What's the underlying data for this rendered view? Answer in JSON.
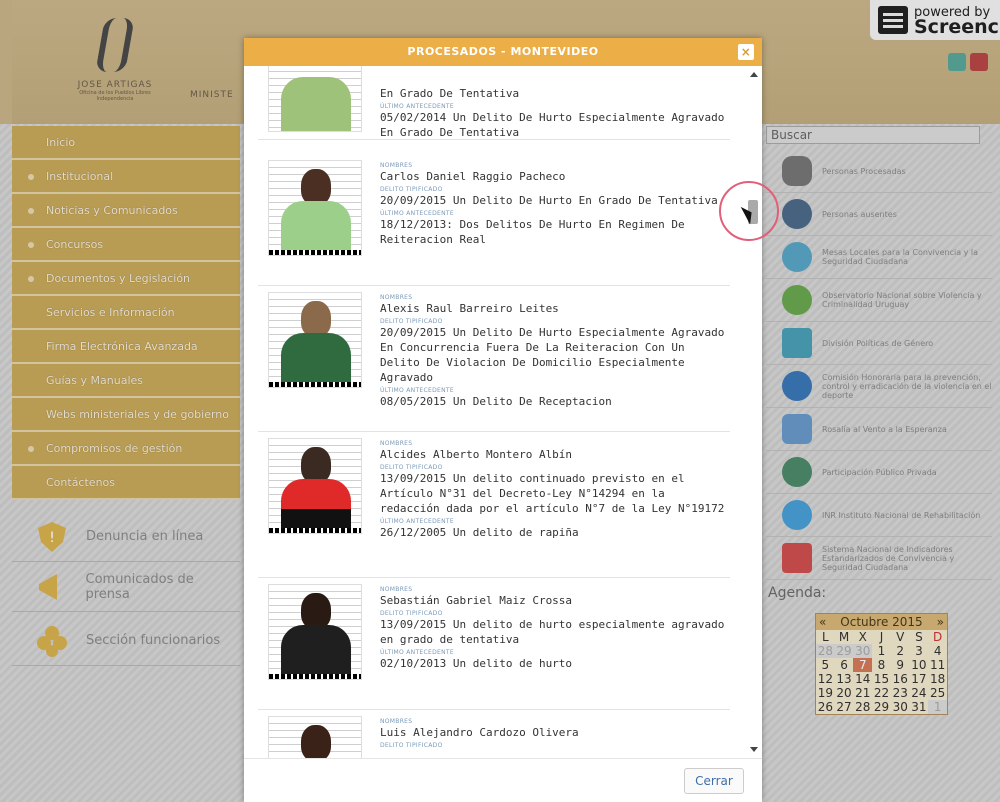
{
  "header": {
    "logo_name": "JOSE ARTIGAS",
    "logo_subtitle": "Oficina de los Pueblos Libres",
    "logo_subtitle2": "Independencia",
    "ministry": "MINISTE",
    "screencast_line1": "powered by",
    "screencast_line2": "Screenc"
  },
  "nav": {
    "items": [
      "Inicio",
      "Institucional",
      "Noticias y Comunicados",
      "Concursos",
      "Documentos y Legislación",
      "Servicios e Información",
      "Firma Electrónica Avanzada",
      "Guías y Manuales",
      "Webs ministeriales y de gobierno",
      "Compromisos de gestión",
      "Contáctenos"
    ]
  },
  "side_links": [
    "Denuncia en línea",
    "Comunicados de prensa",
    "Sección funcionarios"
  ],
  "right": {
    "search_label": "Buscar",
    "items": [
      "Personas Procesadas",
      "Personas ausentes",
      "Mesas Locales para la Convivencia y la Seguridad Ciudadana",
      "Observatorio Nacional sobre Violencia y Criminalidad Uruguay",
      "División Políticas de Género",
      "Comisión Honoraria para la prevención, control y erradicación de la violencia en el deporte",
      "Rosalía al Vento a la Esperanza",
      "Participación Público Privada",
      "INR Instituto Nacional de Rehabilitación",
      "Sistema Nacional de Indicadores Estandarizados de Convivencia y Seguridad Ciudadana"
    ],
    "agenda_label": "Agenda:",
    "calendar": {
      "month": "Octubre 2015",
      "prev": "«",
      "next": "»",
      "weekdays": [
        "L",
        "M",
        "X",
        "J",
        "V",
        "S",
        "D"
      ],
      "days": [
        "28",
        "29",
        "30",
        "1",
        "2",
        "3",
        "4",
        "5",
        "6",
        "7",
        "8",
        "9",
        "10",
        "11",
        "12",
        "13",
        "14",
        "15",
        "16",
        "17",
        "18",
        "19",
        "20",
        "21",
        "22",
        "23",
        "24",
        "25",
        "26",
        "27",
        "28",
        "29",
        "30",
        "31",
        "1"
      ]
    }
  },
  "modal": {
    "title": "PROCESADOS - MONTEVIDEO",
    "close_symbol": "×",
    "close_button": "Cerrar",
    "labels": {
      "nombres": "NOMBRES",
      "delito": "DELITO TIPIFICADO",
      "antecedente": "ÚLTIMO ANTECEDENTE"
    },
    "entries": [
      {
        "nombres": "",
        "delito": "En Grado De Tentativa",
        "antecedente": "05/02/2014 Un Delito De Hurto Especialmente Agravado En Grado De Tentativa"
      },
      {
        "nombres": "Carlos Daniel Raggio Pacheco",
        "delito": "20/09/2015 Un Delito De Hurto En Grado De Tentativa",
        "antecedente": "18/12/2013: Dos Delitos De Hurto En Regimen De Reiteracion Real"
      },
      {
        "nombres": "Alexis Raul Barreiro Leites",
        "delito": "20/09/2015 Un Delito De Hurto Especialmente Agravado En Concurrencia Fuera De La Reiteracion Con Un Delito De Violacion De Domicilio Especialmente Agravado",
        "antecedente": "08/05/2015 Un Delito De Receptacion"
      },
      {
        "nombres": "Alcides Alberto Montero Albín",
        "delito": "13/09/2015 Un delito continuado previsto en el Artículo N°31 del Decreto-Ley N°14294 en la redacción dada por el artículo N°7 de la Ley N°19172",
        "antecedente": "26/12/2005 Un delito de rapiña"
      },
      {
        "nombres": "Sebastián Gabriel Maiz Crossa",
        "delito": "13/09/2015 Un delito de hurto especialmente agravado en grado de tentativa",
        "antecedente": "02/10/2013 Un delito de hurto"
      },
      {
        "nombres": "Luis Alejandro Cardozo Olivera",
        "delito": "",
        "antecedente": ""
      }
    ]
  },
  "colors": {
    "modal_header": "#ecae46",
    "nav": "#c9aa5c",
    "label": "#7a9aba"
  }
}
